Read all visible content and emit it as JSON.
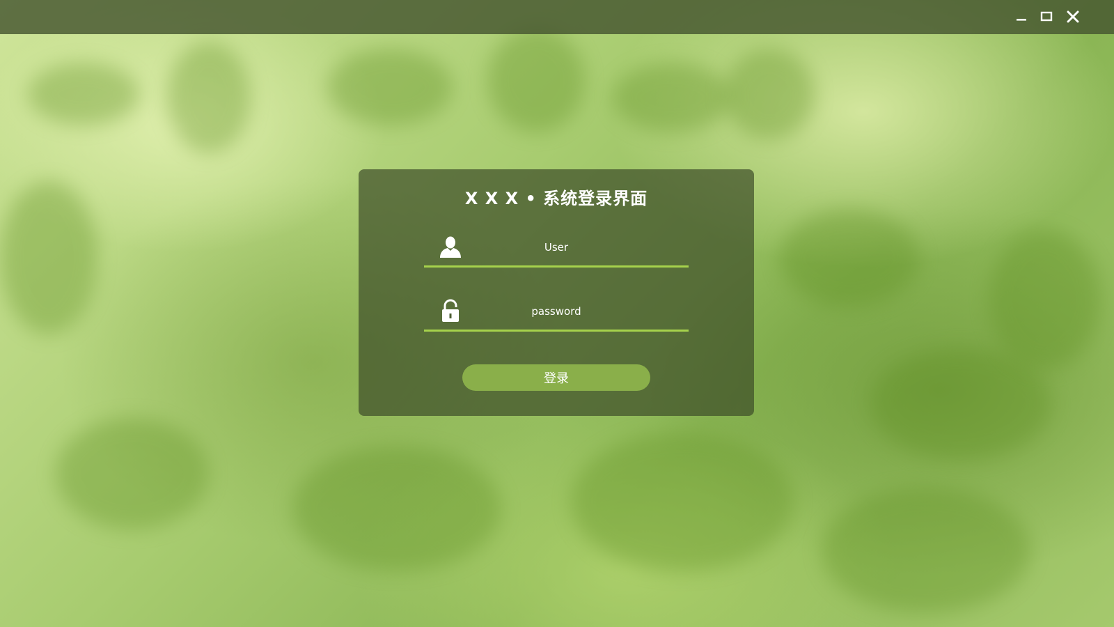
{
  "window": {
    "minimize_label": "minimize",
    "maximize_label": "maximize",
    "close_label": "close"
  },
  "login": {
    "title": "X X X • 系统登录界面",
    "user_placeholder": "User",
    "password_placeholder": "password",
    "submit_label": "登录"
  },
  "colors": {
    "accent_line": "#a6d24c",
    "button_bg": "#8aaf4a",
    "card_bg": "rgba(58,72,38,0.68)",
    "titlebar_bg": "rgba(70,86,48,0.82)"
  },
  "icons": {
    "user": "user-icon",
    "lock": "lock-icon",
    "minimize": "minimize-icon",
    "maximize": "maximize-icon",
    "close": "close-icon"
  }
}
